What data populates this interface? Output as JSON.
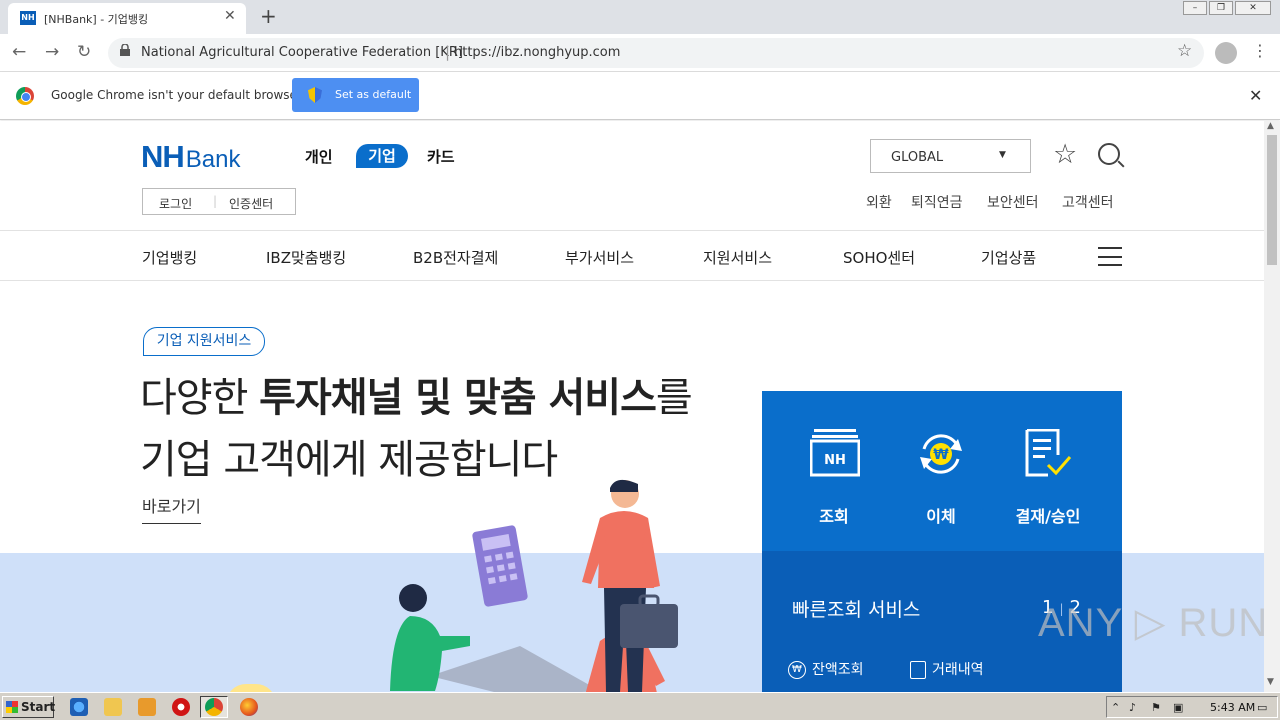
{
  "browser": {
    "tab_title": "[NHBank] - 기업뱅킹",
    "tab_favicon": "NH",
    "address_org": "National Agricultural Cooperative Federation [KR]",
    "address_url": "https://ibz.nonghyup.com",
    "infobar_text": "Google Chrome isn't your default browser",
    "set_default_label": "Set as default"
  },
  "site": {
    "logo_nh": "NH",
    "logo_bank": "Bank",
    "top_nav": [
      "개인",
      "기업",
      "카드"
    ],
    "login": "로그인",
    "cert": "인증센터",
    "global_select": "GLOBAL",
    "util_links": [
      "외환",
      "퇴직연금",
      "보안센터",
      "고객센터"
    ],
    "gnb": [
      "기업뱅킹",
      "IBZ맞춤뱅킹",
      "B2B전자결제",
      "부가서비스",
      "지원서비스",
      "SOHO센터",
      "기업상품"
    ],
    "badge": "기업 지원서비스",
    "hero_line1_pre": "다양한 ",
    "hero_line1_bold": "투자채널 및 맞춤 서비스",
    "hero_line1_post": "를",
    "hero_line2": "기업 고객에게 제공합니다",
    "goto": "바로가기",
    "panel": {
      "items": [
        {
          "label": "조회",
          "icon": "nh-inquiry-icon"
        },
        {
          "label": "이체",
          "icon": "won-transfer-icon"
        },
        {
          "label": "결재/승인",
          "icon": "approval-doc-icon"
        }
      ],
      "nh_icon_text": "NH",
      "won_symbol": "₩",
      "quick_title": "빠른조회 서비스",
      "page_current": "1",
      "page_next": "2",
      "quick_links": [
        "잔액조회",
        "거래내역"
      ]
    }
  },
  "watermark": "ANY ▷ RUN",
  "taskbar": {
    "start": "Start",
    "clock": "5:43 AM"
  },
  "colors": {
    "nh_blue": "#0a5eb7",
    "panel_blue": "#0a6ecb",
    "band": "#cfe0f9"
  }
}
